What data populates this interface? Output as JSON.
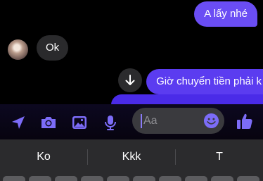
{
  "messages": [
    {
      "from": "me",
      "text": "A lấy nhé"
    },
    {
      "from": "them",
      "text": "Ok"
    },
    {
      "from": "me",
      "text": "Giờ chuyển tiền phải k"
    }
  ],
  "composer": {
    "placeholder": "Aa",
    "icons": [
      "location-arrow-icon",
      "camera-icon",
      "gallery-icon",
      "microphone-icon",
      "emoji-icon",
      "thumbs-up-icon"
    ]
  },
  "keyboard": {
    "suggestions": [
      "Ko",
      "Kkk",
      "T"
    ]
  },
  "colors": {
    "outgoing_bubble": "#6a4df4",
    "incoming_bubble": "#2a2a2c",
    "accent": "#7c6cf8",
    "keyboard_bg": "#2b2b2d"
  }
}
